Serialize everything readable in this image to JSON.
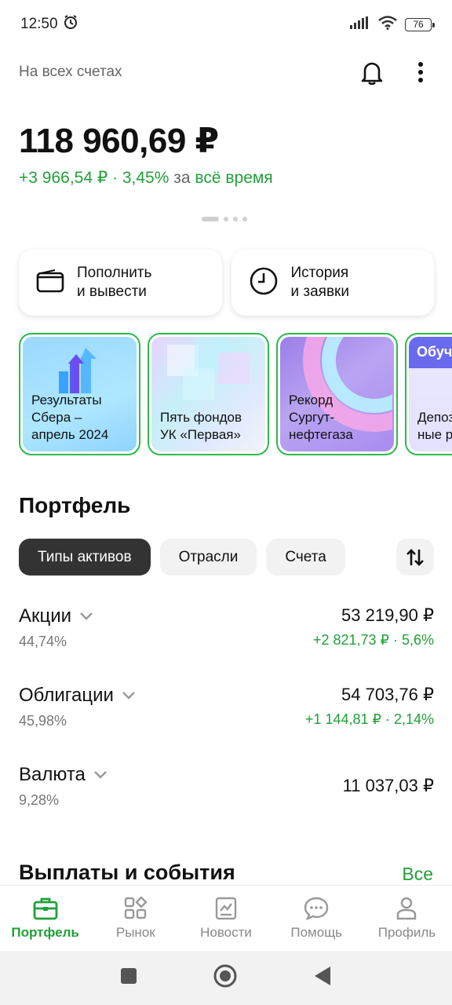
{
  "status_bar": {
    "time": "12:50",
    "battery": "76"
  },
  "header": {
    "label": "На всех счетах"
  },
  "balance": {
    "total": "118 960,69 ₽",
    "change_value": "+3 966,54 ₽ · 3,45%",
    "change_mid": "за",
    "change_period": "всё время"
  },
  "actions": [
    {
      "label": "Пополнить\nи вывести",
      "icon": "wallet-icon"
    },
    {
      "label": "История\nи заявки",
      "icon": "clock-icon"
    }
  ],
  "stories": [
    {
      "title": "Результаты\nСбера –\nапрель 2024"
    },
    {
      "title": "Пять фондов\nУК «Первая»"
    },
    {
      "title": "Рекорд\nСургут-\nнефтегаза"
    },
    {
      "tag": "Обуч",
      "title": "Депоз\nные р"
    }
  ],
  "portfolio": {
    "title": "Портфель",
    "chips": [
      "Типы активов",
      "Отрасли",
      "Счета"
    ],
    "active_chip": 0,
    "assets": [
      {
        "name": "Акции",
        "pct": "44,74%",
        "value": "53 219,90 ₽",
        "change": "+2 821,73 ₽ · 5,6%"
      },
      {
        "name": "Облигации",
        "pct": "45,98%",
        "value": "54 703,76 ₽",
        "change": "+1 144,81 ₽ · 2,14%"
      },
      {
        "name": "Валюта",
        "pct": "9,28%",
        "value": "11 037,03 ₽",
        "change": ""
      }
    ]
  },
  "payouts": {
    "title": "Выплаты и события",
    "all_label": "Все"
  },
  "bottom_nav": [
    {
      "label": "Портфель",
      "icon": "briefcase-icon",
      "active": true
    },
    {
      "label": "Рынок",
      "icon": "market-icon",
      "active": false
    },
    {
      "label": "Новости",
      "icon": "news-icon",
      "active": false
    },
    {
      "label": "Помощь",
      "icon": "chat-icon",
      "active": false
    },
    {
      "label": "Профиль",
      "icon": "profile-icon",
      "active": false
    }
  ],
  "colors": {
    "accent": "#21a038",
    "story_border": "#2dbb4a",
    "chip_active": "#333333"
  }
}
